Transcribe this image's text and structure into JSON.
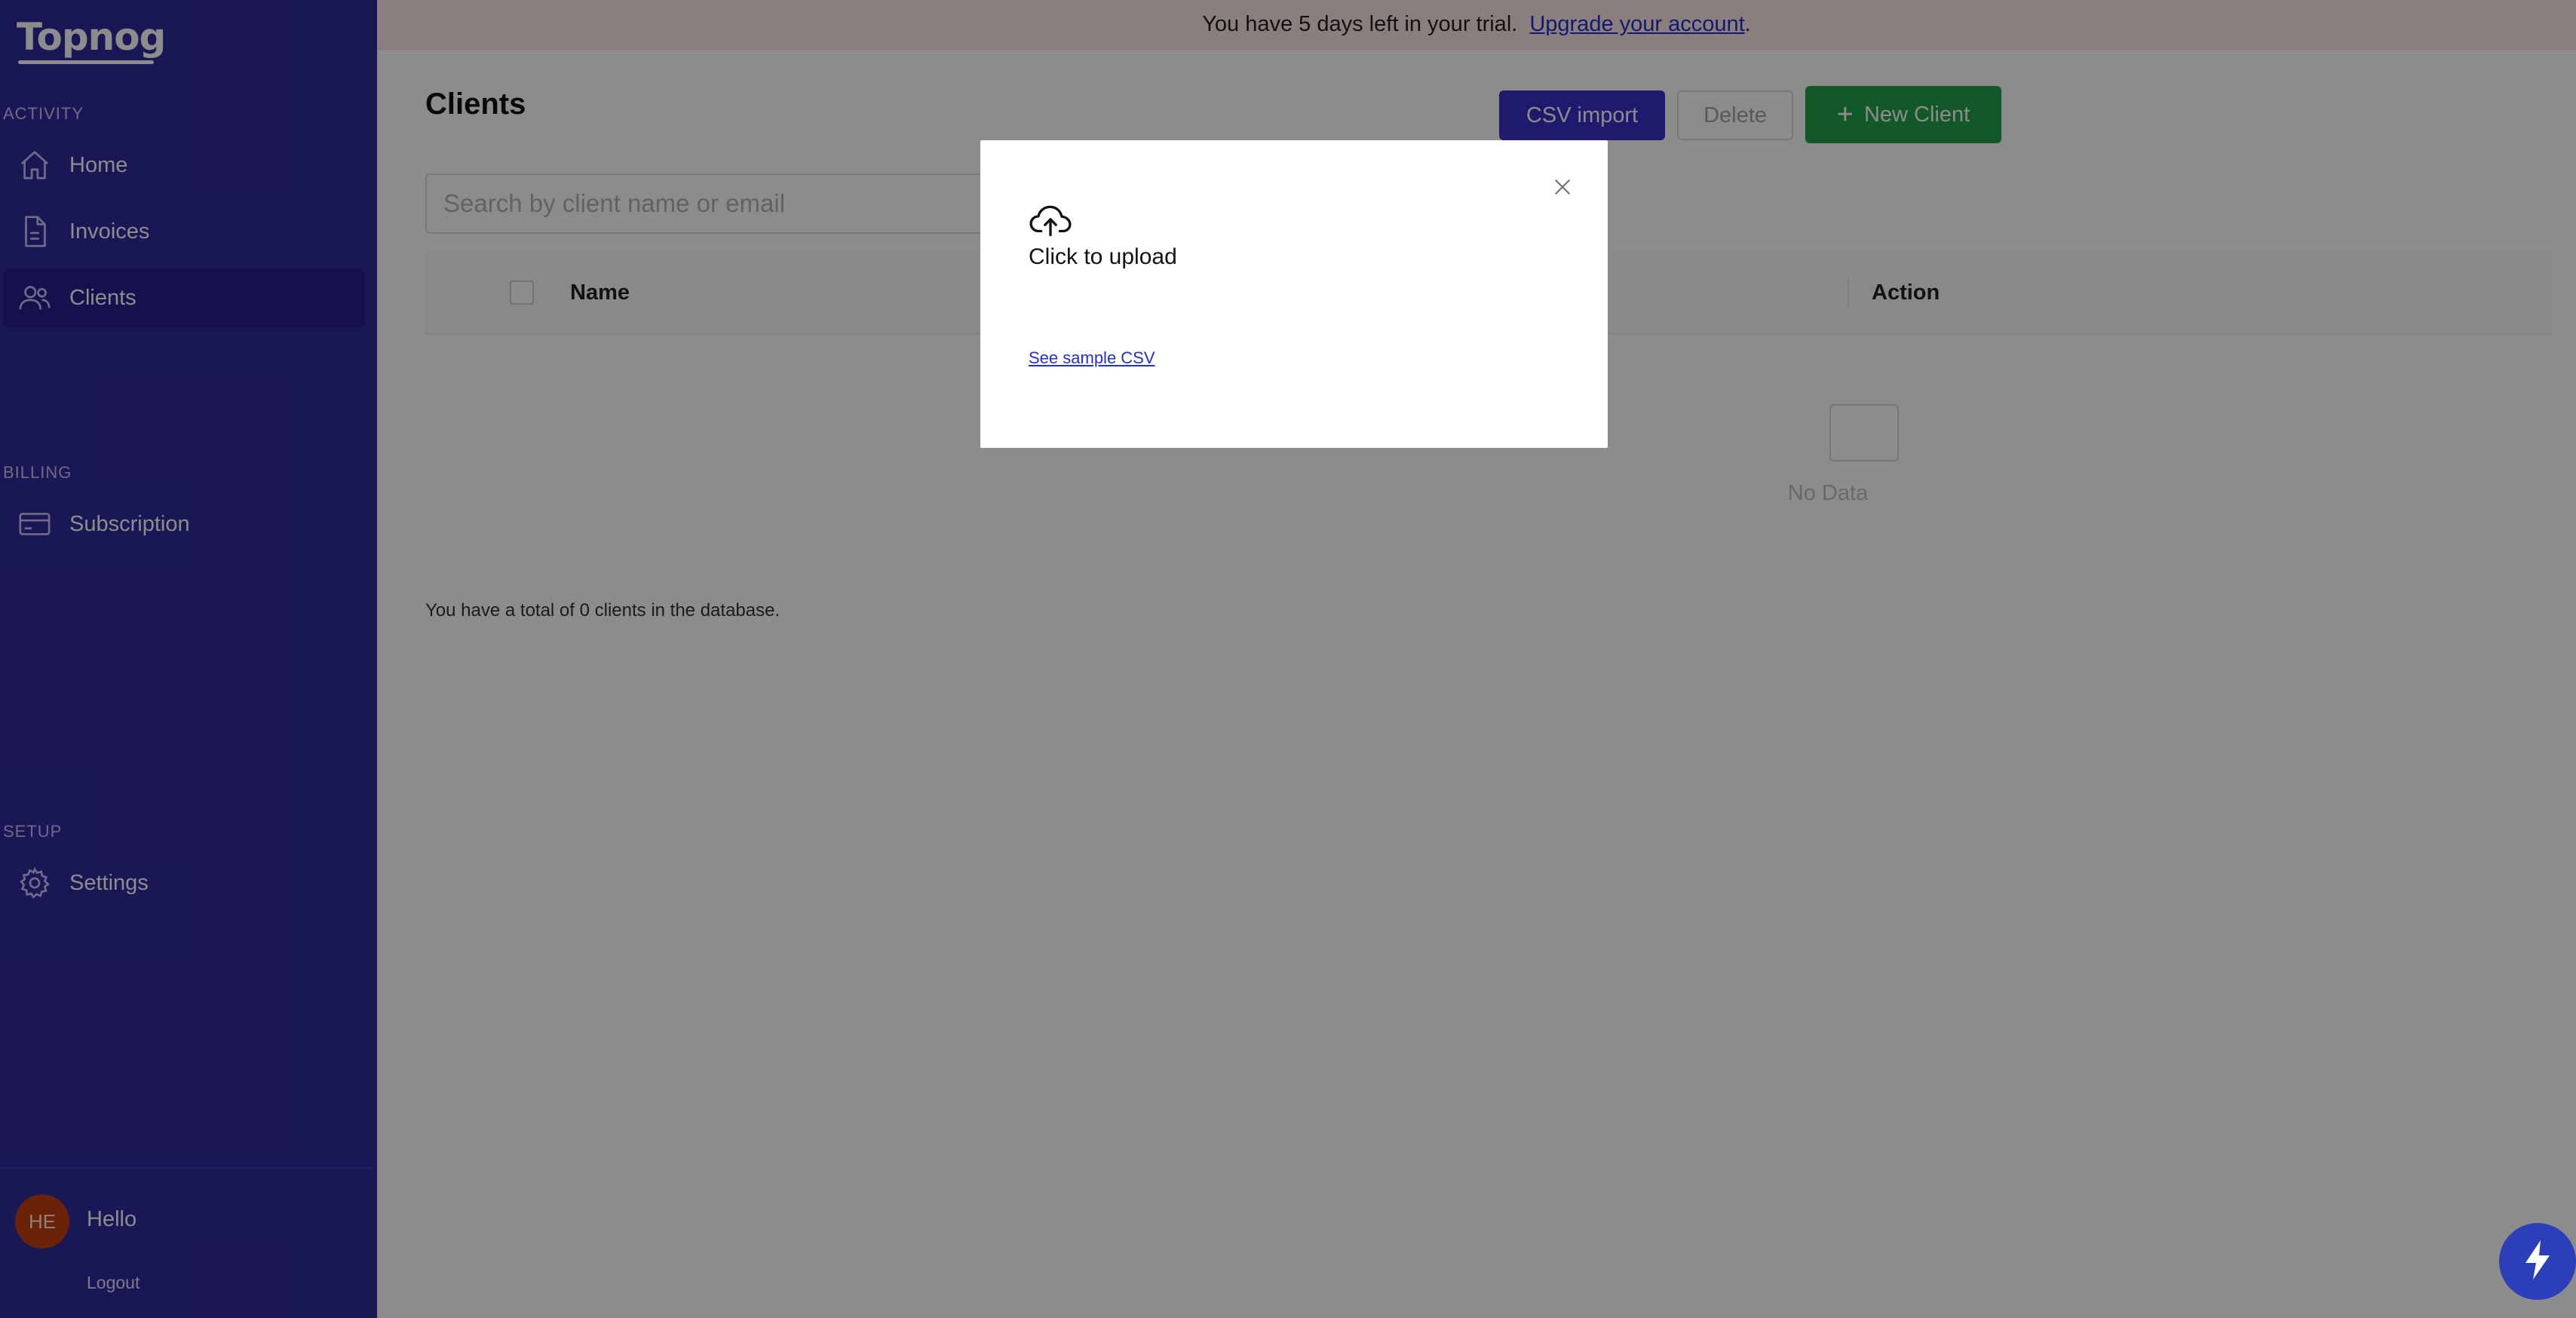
{
  "app": {
    "logo_text": "Topnog"
  },
  "sidebar": {
    "sections": [
      {
        "label": "ACTIVITY",
        "items": [
          {
            "label": "Home",
            "icon": "home-icon"
          },
          {
            "label": "Invoices",
            "icon": "document-icon"
          },
          {
            "label": "Clients",
            "icon": "users-icon",
            "active": true
          }
        ]
      },
      {
        "label": "BILLING",
        "items": [
          {
            "label": "Subscription",
            "icon": "credit-card-icon"
          }
        ]
      },
      {
        "label": "SETUP",
        "items": [
          {
            "label": "Settings",
            "icon": "gear-icon"
          }
        ]
      }
    ],
    "user": {
      "initials": "HE",
      "name": "Hello",
      "logout_label": "Logout"
    }
  },
  "banner": {
    "text": "You have 5 days left in your trial.",
    "link_text": "Upgrade your account",
    "suffix": "."
  },
  "page": {
    "title": "Clients",
    "csv_import_label": "CSV import",
    "delete_label": "Delete",
    "new_client_label": "New Client",
    "search_placeholder": "Search by client name or email"
  },
  "table": {
    "columns": [
      "Name",
      "Action"
    ],
    "empty_text": "No Data",
    "total_text": "You have a total of 0 clients in the database."
  },
  "modal": {
    "upload_label": "Click to upload",
    "sample_link": "See sample CSV",
    "icons": [
      "cloud-upload-icon",
      "close-icon"
    ]
  },
  "colors": {
    "sidebar": "#312a9e",
    "primary_button": "#3a31c9",
    "success_button": "#21a04a",
    "banner": "#fce7e6",
    "link": "#2430c8",
    "avatar": "#c2410c"
  }
}
